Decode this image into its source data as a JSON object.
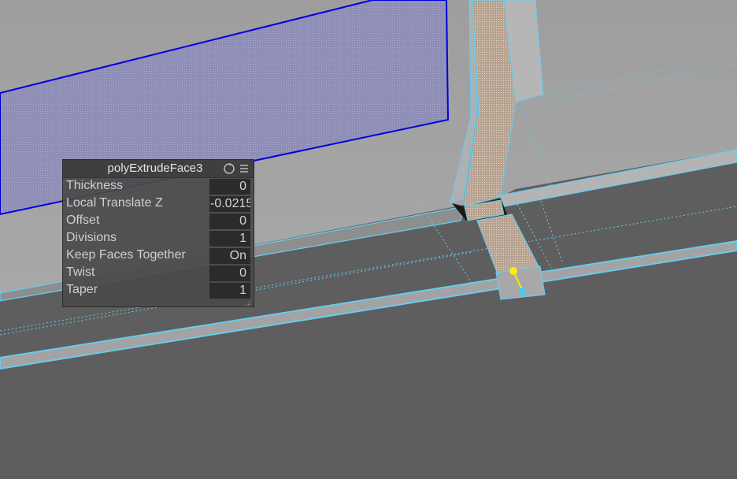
{
  "panel": {
    "title": "polyExtrudeFace3",
    "icons": [
      "refresh-icon",
      "menu-icon",
      "resize-grip-icon"
    ],
    "rows": [
      {
        "label": "Thickness",
        "value": "0"
      },
      {
        "label": "Local Translate Z",
        "value": "-0.0215"
      },
      {
        "label": "Offset",
        "value": "0"
      },
      {
        "label": "Divisions",
        "value": "1"
      },
      {
        "label": "Keep Faces Together",
        "value": "On"
      },
      {
        "label": "Twist",
        "value": "0"
      },
      {
        "label": "Taper",
        "value": "1"
      }
    ]
  },
  "viewport": {
    "colors": {
      "background": "#5c5c5c",
      "wall": "#a0a0a0",
      "selected_face": "#8f8fb8",
      "selected_edge": "#0000e0",
      "highlight_edge": "#66ccee",
      "extruded_face": "#b8a89c",
      "manipulator": "#ffee00"
    }
  }
}
